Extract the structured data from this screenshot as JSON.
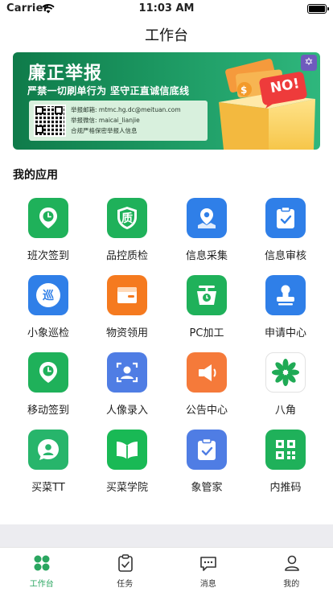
{
  "status_bar": {
    "carrier": "Carrier",
    "time": "11:03 AM"
  },
  "nav": {
    "title": "工作台"
  },
  "banner": {
    "title": "廉正举报",
    "subtitle": "严禁一切刷单行为 坚守正直诚信底线",
    "email_line": "举报邮箱: mtmc.hg.dc@meituan.com",
    "wechat_line": "举报微信: maicai_lianjie",
    "note_line": "合规严格保密举报人信息",
    "badge_text": "NO!",
    "close_glyph": "✡"
  },
  "section": {
    "title": "我的应用"
  },
  "apps": [
    {
      "label": "班次签到",
      "icon": "clock-pin-icon",
      "color": "#1fb15a"
    },
    {
      "label": "品控质检",
      "icon": "quality-shield-icon",
      "color": "#1fb15a",
      "glyph": "质"
    },
    {
      "label": "信息采集",
      "icon": "map-pin-icon",
      "color": "#2f7fe8"
    },
    {
      "label": "信息审核",
      "icon": "clipboard-check-icon",
      "color": "#2f7fe8"
    },
    {
      "label": "小象巡检",
      "icon": "patrol-icon",
      "color": "#2f7fe8",
      "glyph": "巡"
    },
    {
      "label": "物资领用",
      "icon": "box-icon",
      "color": "#f57a1f"
    },
    {
      "label": "PC加工",
      "icon": "scale-icon",
      "color": "#1fb15a"
    },
    {
      "label": "申请中心",
      "icon": "stamp-icon",
      "color": "#2f7fe8"
    },
    {
      "label": "移动签到",
      "icon": "clock-pin-icon",
      "color": "#1fb15a"
    },
    {
      "label": "人像录入",
      "icon": "face-scan-icon",
      "color": "#4f7de4"
    },
    {
      "label": "公告中心",
      "icon": "megaphone-icon",
      "color": "#f57a3a"
    },
    {
      "label": "八角",
      "icon": "leaf-star-icon",
      "color": "#ffffff"
    },
    {
      "label": "买菜TT",
      "icon": "chat-person-icon",
      "color": "#27b56b"
    },
    {
      "label": "买菜学院",
      "icon": "open-book-icon",
      "color": "#19b955"
    },
    {
      "label": "象管家",
      "icon": "clipboard-check-icon",
      "color": "#4f7de4"
    },
    {
      "label": "内推码",
      "icon": "qr-code-icon",
      "color": "#1fb15a"
    }
  ],
  "tabs": [
    {
      "label": "工作台",
      "icon": "workbench-icon",
      "active": true
    },
    {
      "label": "任务",
      "icon": "task-clipboard-icon",
      "active": false
    },
    {
      "label": "消息",
      "icon": "message-icon",
      "active": false
    },
    {
      "label": "我的",
      "icon": "profile-icon",
      "active": false
    }
  ],
  "colors": {
    "accent": "#2aa660",
    "banner_green": "#1b9660",
    "tab_inactive": "#333333"
  }
}
